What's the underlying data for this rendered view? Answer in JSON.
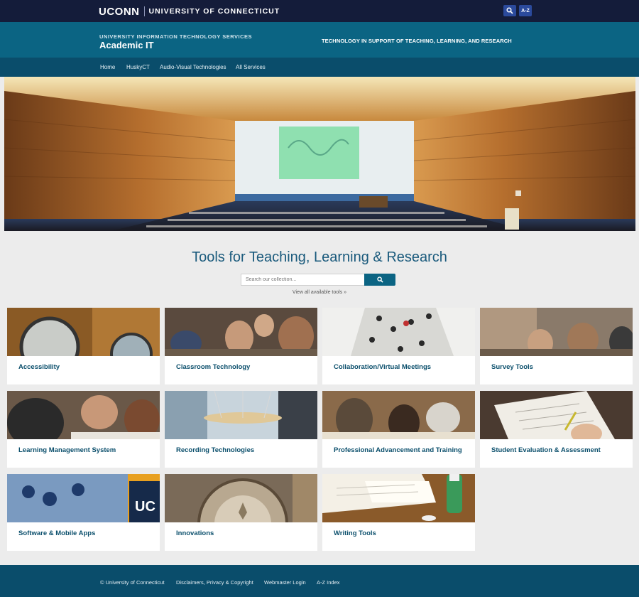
{
  "topbar": {
    "brand": "UCONN",
    "university": "UNIVERSITY OF CONNECTICUT",
    "search_icon": "search-icon",
    "az_label": "A-Z"
  },
  "header": {
    "department": "UNIVERSITY INFORMATION TECHNOLOGY SERVICES",
    "title": "Academic IT",
    "tagline": "TECHNOLOGY IN SUPPORT OF TEACHING, LEARNING, AND RESEARCH"
  },
  "nav": {
    "items": [
      "Home",
      "HuskyCT",
      "Audio-Visual Technologies",
      "All Services"
    ]
  },
  "tools": {
    "title": "Tools for Teaching, Learning & Research",
    "search_placeholder": "Search our collection...",
    "view_all": "View all available tools »"
  },
  "cards": [
    {
      "label": "Accessibility"
    },
    {
      "label": "Classroom Technology"
    },
    {
      "label": "Collaboration/Virtual Meetings"
    },
    {
      "label": "Survey Tools"
    },
    {
      "label": "Learning Management System"
    },
    {
      "label": "Recording Technologies"
    },
    {
      "label": "Professional Advancement and Training"
    },
    {
      "label": "Student Evaluation & Assessment"
    },
    {
      "label": "Software & Mobile Apps"
    },
    {
      "label": "Innovations"
    },
    {
      "label": "Writing Tools"
    }
  ],
  "footer": {
    "items": [
      "© University of Connecticut",
      "Disclaimers, Privacy & Copyright",
      "Webmaster Login",
      "A-Z Index"
    ]
  },
  "colors": {
    "topbar": "#141c3a",
    "header": "#0b6483",
    "nav": "#0a4d6b",
    "accent": "#1a5a7c"
  }
}
